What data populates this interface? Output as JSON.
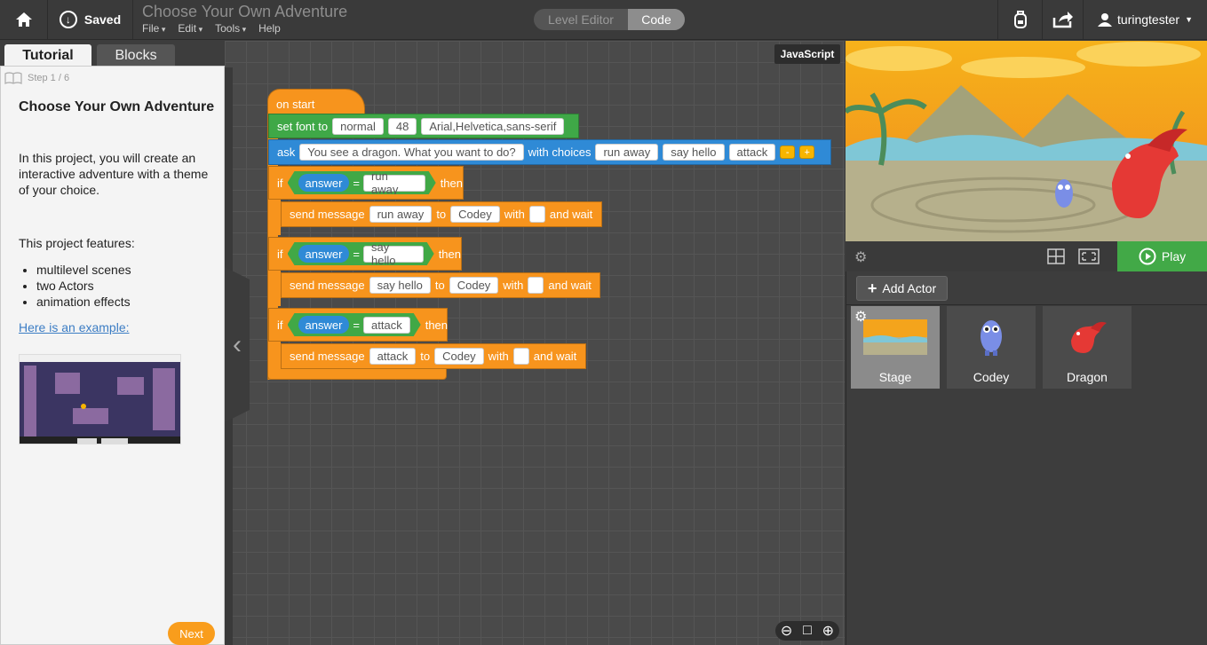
{
  "topbar": {
    "saved_label": "Saved",
    "project_title": "Choose Your Own Adventure",
    "menu": [
      "File",
      "Edit",
      "Tools",
      "Help"
    ],
    "mode_level_editor": "Level Editor",
    "mode_code": "Code",
    "username": "turingtester"
  },
  "tabs": {
    "tutorial": "Tutorial",
    "blocks": "Blocks"
  },
  "tutorial": {
    "step": "Step 1 / 6",
    "title": "Choose Your Own Adventure",
    "intro": "In this project, you will create an interactive adventure with a theme of your choice.",
    "features_heading": "This project features:",
    "features": [
      "multilevel scenes",
      "two Actors",
      "animation effects"
    ],
    "example_link": "Here is an example:",
    "next": "Next"
  },
  "workspace": {
    "js_button": "JavaScript"
  },
  "blocks": {
    "on_start": "on start",
    "set_font": {
      "label": "set font to",
      "style": "normal",
      "size": "48",
      "family": "Arial,Helvetica,sans-serif"
    },
    "ask": {
      "label": "ask",
      "question": "You see a dragon. What you want to do?",
      "with_choices": "with choices",
      "choices": [
        "run away",
        "say hello",
        "attack"
      ]
    },
    "if_label": "if",
    "then_label": "then",
    "answer_label": "answer",
    "eq_label": "=",
    "send_message_label": "send message",
    "to_label": "to",
    "with_label": "with",
    "and_wait_label": "and wait",
    "conditions": [
      "run away",
      "say hello",
      "attack"
    ],
    "messages": [
      "run away",
      "say hello",
      "attack"
    ],
    "target": "Codey"
  },
  "stage": {
    "play_label": "Play"
  },
  "actors": {
    "add_actor": "Add Actor",
    "list": [
      "Stage",
      "Codey",
      "Dragon"
    ]
  }
}
